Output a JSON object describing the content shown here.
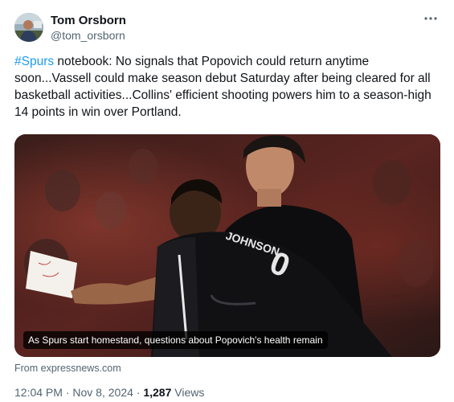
{
  "author": {
    "name": "Tom Orsborn",
    "handle": "@tom_orsborn"
  },
  "more_icon": "more-horizontal-icon",
  "tweet": {
    "hashtag": "#Spurs",
    "text": " notebook: No signals that Popovich could return anytime soon...Vassell could make season debut Saturday after being cleared for all basketball activities...Collins' efficient shooting powers him to a season-high 14 points in win over Portland."
  },
  "card": {
    "caption": "As Spurs start homestand, questions about Popovich's health remain",
    "jersey_text": "JOHNSON",
    "jersey_number": "0"
  },
  "source": "From expressnews.com",
  "meta": {
    "time": "12:04 PM",
    "separator": " · ",
    "date": "Nov 8, 2024",
    "views_count": "1,287",
    "views_label": " Views"
  },
  "colors": {
    "link": "#1d9bf0",
    "text": "#0f1419",
    "secondary": "#536471"
  }
}
